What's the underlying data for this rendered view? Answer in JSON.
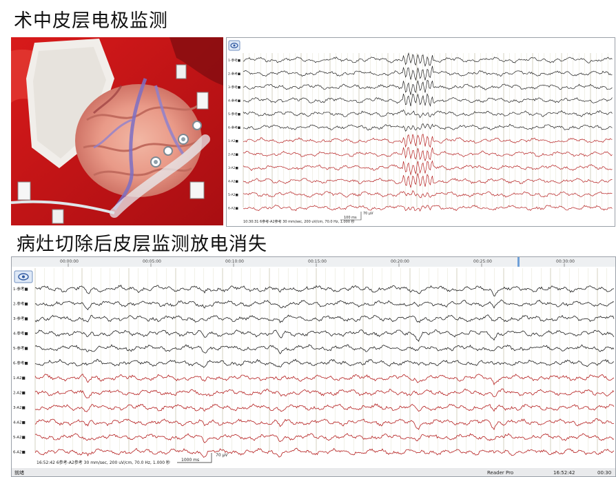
{
  "title_top": "术中皮层电极监测",
  "title_bottom": "病灶切除后皮层监测放电消失",
  "colors": {
    "black_trace": "#1c1c1c",
    "red_trace": "#b41c1c",
    "grid": "#e3e1cf"
  },
  "eeg_top": {
    "view_icon": "eye-icon",
    "channels": [
      "1-参考■",
      "2-参考■",
      "3-参考■",
      "4-参考■",
      "5-参考■",
      "6-参考■",
      "1-A2■",
      "2-A2■",
      "3-A2■",
      "4-A2■",
      "5-A2■",
      "6-A2■"
    ],
    "status_text": "10:30:31 6参考-A2参考 30 mm/sec, 200 uV/cm, 70.0 Hz, 1.000 秒",
    "scale_time": "100 ms",
    "scale_amp": "70 μV"
  },
  "eeg_bottom": {
    "view_icon": "eye-icon",
    "time_ticks": [
      "00:00:00",
      "00:05:00",
      "00:10:00",
      "00:15:00",
      "00:20:00",
      "00:25:00",
      "00:30:00"
    ],
    "channels": [
      "1-参考■",
      "2-参考■",
      "3-参考■",
      "4-参考■",
      "5-参考■",
      "6-参考■",
      "1-A2■",
      "2-A2■",
      "3-A2■",
      "4-A2■",
      "5-A2■",
      "6-A2■"
    ],
    "status_text": "16:52:42 6参考-A2参考 30 mm/sec, 200 uV/cm, 70.0 Hz, 1.000 秒",
    "scale_time": "1000 ms",
    "scale_amp": "70 μV",
    "bottom_left": "就绪",
    "bottom_mid": "Reader Pro",
    "bottom_time": "16:52:42",
    "bottom_right": "00:30"
  }
}
